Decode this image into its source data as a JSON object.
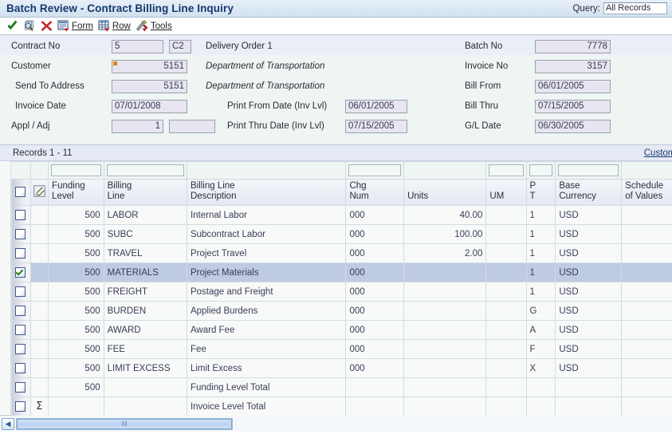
{
  "window": {
    "title": "Batch Review - Contract Billing Line Inquiry",
    "query_label": "Query:",
    "query_value": "All Records"
  },
  "toolbar": {
    "items": [
      {
        "icon": "check-icon",
        "label": ""
      },
      {
        "icon": "find-icon",
        "label": ""
      },
      {
        "icon": "delete-icon",
        "label": ""
      },
      {
        "icon": "form-icon",
        "label": "Form"
      },
      {
        "icon": "row-icon",
        "label": "Row"
      },
      {
        "icon": "tools-icon",
        "label": "Tools"
      }
    ]
  },
  "header_form": {
    "left": [
      {
        "label": "Contract No",
        "value": "5",
        "value2": "C2",
        "marker": false
      },
      {
        "label": "Customer",
        "value": "5151",
        "marker": true
      },
      {
        "label": "Send To Address",
        "value": "5151",
        "marker": false
      },
      {
        "label": "Invoice Date",
        "value": "07/01/2008",
        "marker": false
      },
      {
        "label": "Appl / Adj",
        "value": "1",
        "value2": "",
        "marker": false
      }
    ],
    "middle": [
      {
        "text": "Delivery Order 1",
        "style": "plain"
      },
      {
        "text": "Department of Transportation",
        "style": "italic"
      },
      {
        "text": "Department of Transportation",
        "style": "italic"
      },
      {
        "label": "Print From Date (Inv Lvl)",
        "value": "06/01/2005"
      },
      {
        "label": "Print Thru Date (Inv Lvl)",
        "value": "07/15/2005"
      }
    ],
    "right": [
      {
        "label": "Batch No",
        "value": "7778"
      },
      {
        "label": "Invoice No",
        "value": "3157"
      },
      {
        "label": "Bill From",
        "value": "06/01/2005"
      },
      {
        "label": "Bill Thru",
        "value": "07/15/2005"
      },
      {
        "label": "G/L Date",
        "value": "06/30/2005"
      }
    ]
  },
  "grid": {
    "records_text": "Records  1 - 11",
    "customize_link": "Customize Grid",
    "columns": [
      {
        "line1": "Funding",
        "line2": "Level",
        "align": "right",
        "qbe": true
      },
      {
        "line1": "Billing",
        "line2": "Line",
        "align": "left",
        "qbe": true
      },
      {
        "line1": "Billing Line",
        "line2": "Description",
        "align": "left",
        "qbe": false
      },
      {
        "line1": "Chg",
        "line2": "Num",
        "align": "left",
        "qbe": true
      },
      {
        "line1": "",
        "line2": "Units",
        "align": "right",
        "qbe": false
      },
      {
        "line1": "",
        "line2": "UM",
        "align": "left",
        "qbe": true
      },
      {
        "line1": "P",
        "line2": "T",
        "align": "left",
        "qbe": true
      },
      {
        "line1": "Base",
        "line2": "Currency",
        "align": "left",
        "qbe": true
      },
      {
        "line1": "Schedule",
        "line2": "of Values",
        "align": "left",
        "qbe": false
      }
    ],
    "rows": [
      {
        "selected": false,
        "attach": "",
        "funding_level": "500",
        "billing_line": "LABOR",
        "description": "Internal Labor",
        "chg_num": "000",
        "units": "40.00",
        "um": "",
        "pt": "1",
        "base_currency": "USD",
        "schedule_of_values": "",
        "total": false
      },
      {
        "selected": false,
        "attach": "",
        "funding_level": "500",
        "billing_line": "SUBC",
        "description": "Subcontract Labor",
        "chg_num": "000",
        "units": "100.00",
        "um": "",
        "pt": "1",
        "base_currency": "USD",
        "schedule_of_values": "",
        "total": false
      },
      {
        "selected": false,
        "attach": "",
        "funding_level": "500",
        "billing_line": "TRAVEL",
        "description": "Project Travel",
        "chg_num": "000",
        "units": "2.00",
        "um": "",
        "pt": "1",
        "base_currency": "USD",
        "schedule_of_values": "",
        "total": false
      },
      {
        "selected": true,
        "attach": "",
        "funding_level": "500",
        "billing_line": "MATERIALS",
        "description": "Project Materials",
        "chg_num": "000",
        "units": "",
        "um": "",
        "pt": "1",
        "base_currency": "USD",
        "schedule_of_values": "",
        "total": false
      },
      {
        "selected": false,
        "attach": "",
        "funding_level": "500",
        "billing_line": "FREIGHT",
        "description": "Postage and Freight",
        "chg_num": "000",
        "units": "",
        "um": "",
        "pt": "1",
        "base_currency": "USD",
        "schedule_of_values": "",
        "total": false
      },
      {
        "selected": false,
        "attach": "",
        "funding_level": "500",
        "billing_line": "BURDEN",
        "description": "Applied Burdens",
        "chg_num": "000",
        "units": "",
        "um": "",
        "pt": "G",
        "base_currency": "USD",
        "schedule_of_values": "",
        "total": false
      },
      {
        "selected": false,
        "attach": "",
        "funding_level": "500",
        "billing_line": "AWARD",
        "description": " Award Fee",
        "chg_num": "000",
        "units": "",
        "um": "",
        "pt": "A",
        "base_currency": "USD",
        "schedule_of_values": "",
        "total": false
      },
      {
        "selected": false,
        "attach": "",
        "funding_level": "500",
        "billing_line": "FEE",
        "description": "Fee",
        "chg_num": "000",
        "units": "",
        "um": "",
        "pt": "F",
        "base_currency": "USD",
        "schedule_of_values": "",
        "total": false
      },
      {
        "selected": false,
        "attach": "",
        "funding_level": "500",
        "billing_line": "LIMIT EXCESS",
        "description": "Limit Excess",
        "chg_num": "000",
        "units": "",
        "um": "",
        "pt": "X",
        "base_currency": "USD",
        "schedule_of_values": "",
        "total": false
      },
      {
        "selected": false,
        "attach": "",
        "funding_level": "500",
        "billing_line": "",
        "description": "Funding Level Total",
        "chg_num": "",
        "units": "",
        "um": "",
        "pt": "",
        "base_currency": "",
        "schedule_of_values": "",
        "total": true
      },
      {
        "selected": false,
        "attach": "sigma-icon",
        "funding_level": "",
        "billing_line": "",
        "description": "Invoice Level Total",
        "chg_num": "",
        "units": "",
        "um": "",
        "pt": "",
        "base_currency": "",
        "schedule_of_values": "",
        "total": true
      }
    ]
  },
  "scrollbar": {
    "left_arrow": "◀",
    "grip": "‖‖"
  },
  "colors": {
    "title_text": "#16386e",
    "total_text": "#1a1ad0",
    "selection": "#bfcbe0",
    "marker": "#e8820c",
    "header_bg": "#eef5f3"
  }
}
